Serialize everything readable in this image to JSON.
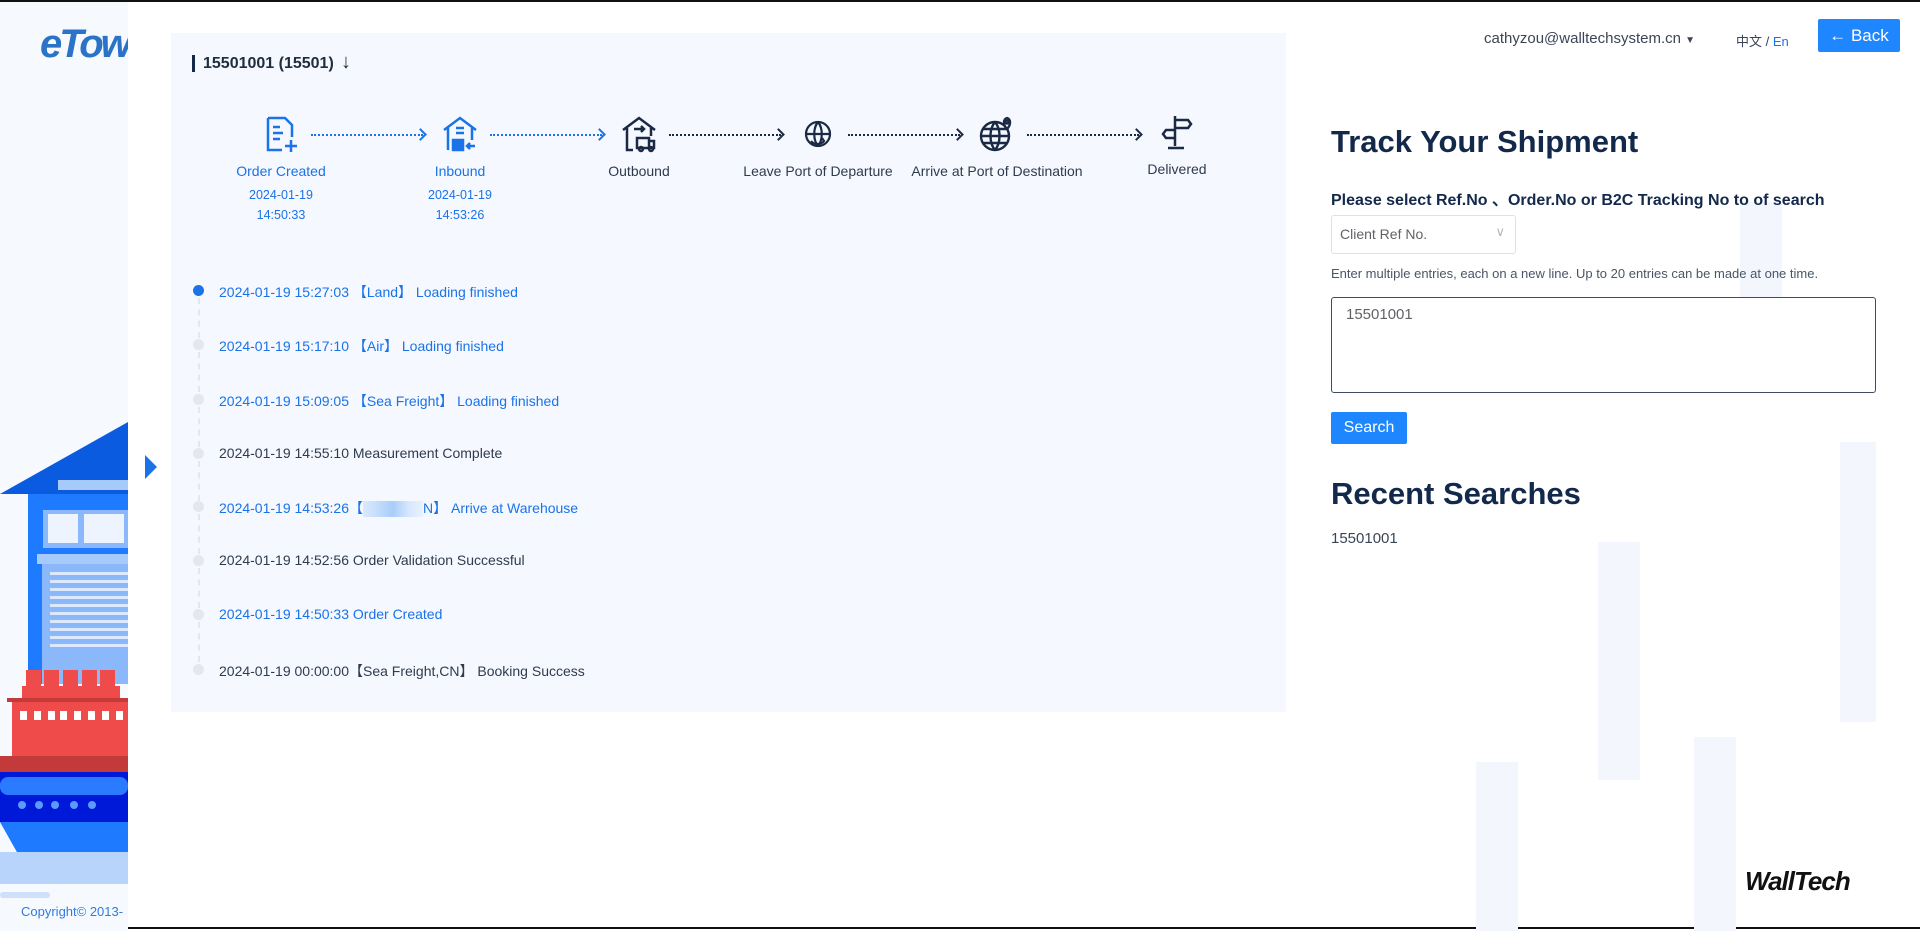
{
  "brand": {
    "logo": "eTow",
    "copyright": "Copyright© 2013-",
    "footer_logo": "WallTech"
  },
  "header": {
    "user_email": "cathyzou@walltechsystem.cn",
    "lang_zh": "中文",
    "lang_sep": "/",
    "lang_en": "En",
    "back_label": "← Back"
  },
  "order": {
    "title": "15501001 (15501)"
  },
  "steps": [
    {
      "label": "Order Created",
      "date": "2024-01-19",
      "time": "14:50:33",
      "status": "done",
      "icon": "document-plus-icon"
    },
    {
      "label": "Inbound",
      "date": "2024-01-19",
      "time": "14:53:26",
      "status": "done",
      "icon": "warehouse-inbound-icon"
    },
    {
      "label": "Outbound",
      "status": "pending",
      "icon": "warehouse-truck-icon"
    },
    {
      "label": "Leave Port of Departure",
      "status": "pending",
      "icon": "globe-cycle-icon"
    },
    {
      "label": "Arrive at Port of Destination",
      "status": "pending",
      "icon": "globe-pin-icon"
    },
    {
      "label": "Delivered",
      "status": "pending",
      "icon": "signpost-icon"
    }
  ],
  "events": [
    {
      "text": "2024-01-19 15:27:03 【Land】 Loading finished",
      "highlight": true
    },
    {
      "text": "2024-01-19 15:17:10 【Air】 Loading finished",
      "highlight": true
    },
    {
      "text": "2024-01-19 15:09:05 【Sea Freight】 Loading finished",
      "highlight": true
    },
    {
      "text": "2024-01-19 14:55:10 Measurement Complete",
      "highlight": false
    },
    {
      "pre": "2024-01-19 14:53:26【",
      "post": "N】 Arrive at Warehouse",
      "highlight": true
    },
    {
      "text": "2024-01-19 14:52:56 Order Validation Successful",
      "highlight": false
    },
    {
      "text": "2024-01-19 14:50:33 Order Created",
      "highlight": true
    },
    {
      "text": "2024-01-19 00:00:00【Sea Freight,CN】 Booking Success",
      "highlight": false
    }
  ],
  "search": {
    "title": "Track Your Shipment",
    "select_label": "Please select Ref.No 、Order.No or B2C Tracking No to of search",
    "select_value": "Client Ref No.",
    "hint": "Enter multiple entries, each on a new line. Up to 20 entries can be made at one time.",
    "entries_value": "15501001",
    "button": "Search"
  },
  "recent": {
    "title": "Recent Searches",
    "items": [
      "15501001"
    ]
  },
  "colors": {
    "accent": "#1e87ff",
    "navy": "#13294b",
    "card_bg": "#f5f8fe"
  }
}
